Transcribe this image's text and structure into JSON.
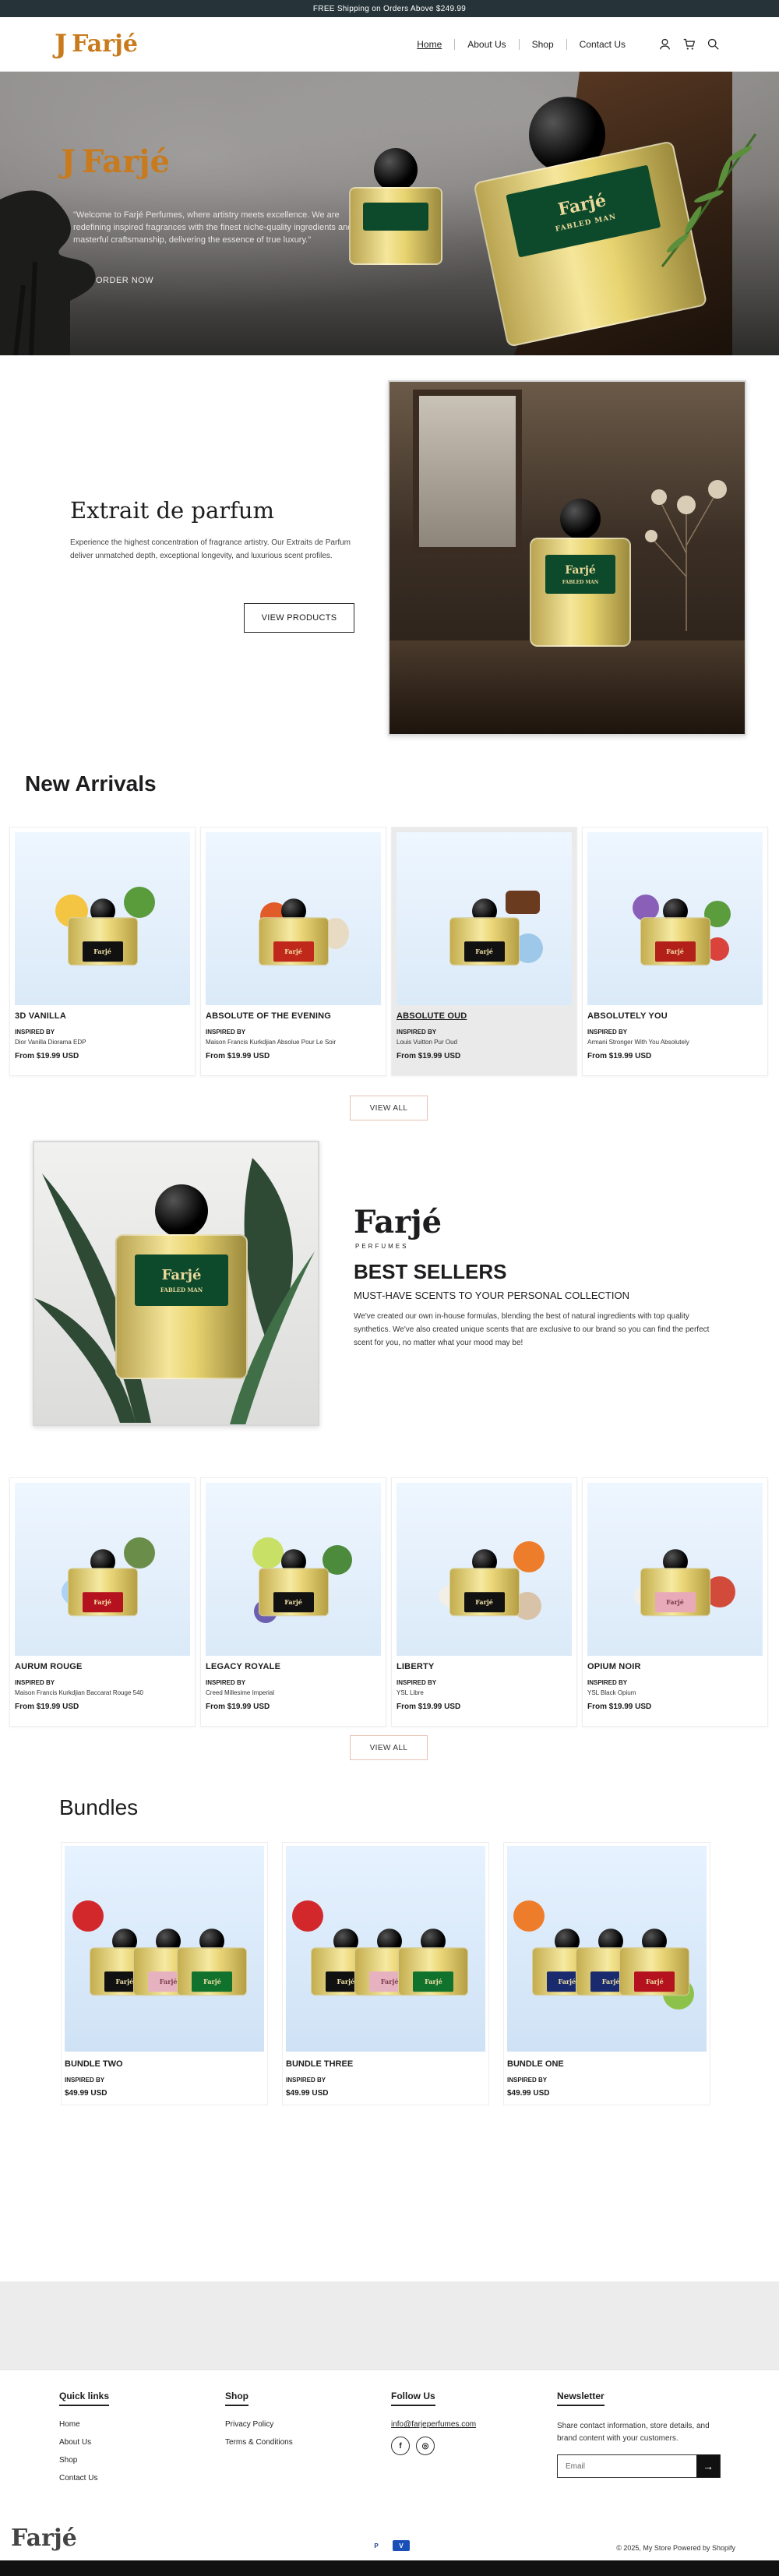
{
  "announcement": "FREE Shipping on Orders Above $249.99",
  "header": {
    "logo_mark": "J",
    "logo_text": "Farjé",
    "nav": [
      "Home",
      "About Us",
      "Shop",
      "Contact Us"
    ]
  },
  "hero": {
    "logo_mark": "J",
    "logo_text": "Farjé",
    "text": "\"Welcome to Farjé Perfumes, where artistry meets excellence. We are redefining inspired fragrances with the finest niche-quality ingredients and masterful craftsmanship, delivering the essence of true luxury.\"",
    "cta": "ORDER NOW",
    "bottle_brand": "Farjé",
    "bottle_name": "FABLED MAN"
  },
  "extrait": {
    "title": "Extrait de parfum",
    "text": "Experience the highest concentration of fragrance artistry. Our Extraits de Parfum deliver unmatched depth, exceptional longevity, and luxurious scent profiles.",
    "cta": "VIEW PRODUCTS",
    "bottle_brand": "Farjé",
    "bottle_name": "FABLED MAN"
  },
  "new_arrivals": {
    "title": "New Arrivals",
    "inspired_label": "INSPIRED BY",
    "view_all": "VIEW ALL",
    "products": [
      {
        "name": "3D VANILLA",
        "inspired": "Dior Vanilla Diorama EDP",
        "price": "From $19.99 USD",
        "label_color": "#111111"
      },
      {
        "name": "ABSOLUTE OF THE EVENING",
        "inspired": "Maison Francis Kurkdjian Absolue Pour Le Soir",
        "price": "From $19.99 USD",
        "label_color": "#c0281c"
      },
      {
        "name": "ABSOLUTE OUD",
        "inspired": "Louis Vuitton Pur Oud",
        "price": "From $19.99 USD",
        "label_color": "#111111"
      },
      {
        "name": "ABSOLUTELY YOU",
        "inspired": "Armani Stronger With You Absolutely",
        "price": "From $19.99 USD",
        "label_color": "#b3201a"
      }
    ]
  },
  "best_sellers": {
    "brand": "Farjé",
    "brand_sub": "PERFUMES",
    "title": "BEST SELLERS",
    "subtitle": "MUST-HAVE SCENTS TO YOUR PERSONAL COLLECTION",
    "text": "We've created our own in-house formulas, blending the best of natural ingredients with top quality synthetics. We've also created unique scents that are exclusive to our brand so you can find the perfect scent for you, no matter what your mood may be!",
    "inspired_label": "INSPIRED BY",
    "view_all": "VIEW ALL",
    "bottle_brand": "Farjé",
    "bottle_name": "FABLED MAN",
    "products": [
      {
        "name": "AURUM ROUGE",
        "inspired": "Maison Francis Kurkdjian Baccarat Rouge 540",
        "price": "From $19.99 USD",
        "label_color": "#b3121e"
      },
      {
        "name": "LEGACY ROYALE",
        "inspired": "Creed Millesime Imperial",
        "price": "From $19.99 USD",
        "label_color": "#111111"
      },
      {
        "name": "LIBERTY",
        "inspired": "YSL Libre",
        "price": "From $19.99 USD",
        "label_color": "#111111"
      },
      {
        "name": "OPIUM NOIR",
        "inspired": "YSL Black Opium",
        "price": "From $19.99 USD",
        "label_color": "#e8a9b8"
      }
    ]
  },
  "bundles": {
    "title": "Bundles",
    "inspired_label": "INSPIRED BY",
    "items": [
      {
        "name": "BUNDLE TWO",
        "price": "$49.99 USD",
        "labels": [
          "#111111",
          "#e6b2c0",
          "#11722e"
        ]
      },
      {
        "name": "BUNDLE THREE",
        "price": "$49.99 USD",
        "labels": [
          "#111111",
          "#e6b2c0",
          "#11722e"
        ]
      },
      {
        "name": "BUNDLE ONE",
        "price": "$49.99 USD",
        "labels": [
          "#1a2a6e",
          "#1a2a6e",
          "#b3121e"
        ]
      }
    ]
  },
  "footer": {
    "quick_links_title": "Quick links",
    "quick_links": [
      "Home",
      "About Us",
      "Shop",
      "Contact Us"
    ],
    "shop_title": "Shop",
    "shop_links": [
      "Privacy Policy",
      "Terms & Conditions"
    ],
    "follow_title": "Follow Us",
    "email": "info@farjeperfumes.com",
    "newsletter_title": "Newsletter",
    "newsletter_text": "Share contact information, store details, and brand content with your customers.",
    "email_placeholder": "Email",
    "copyright": "© 2025, My Store Powered by Shopify",
    "logo_text": "Farjé"
  },
  "colors": {
    "accent": "#c87a1c",
    "announcement_bg": "#26343a",
    "label_green": "#0d4a2c"
  }
}
